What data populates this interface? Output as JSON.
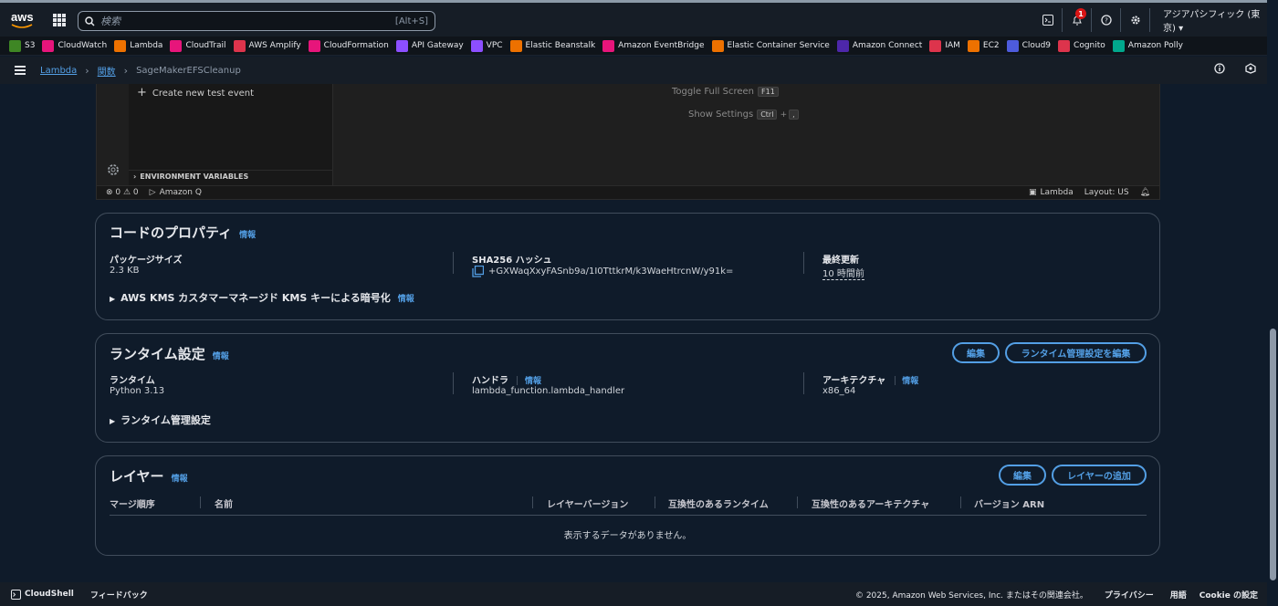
{
  "topbar": {
    "logo_text": "aws",
    "search_placeholder": "検索",
    "search_shortcut": "[Alt+S]",
    "notification_count": "1",
    "region": "アジアパシフィック (東京) ▾"
  },
  "favorites": [
    {
      "label": "S3",
      "color": "#3e8624"
    },
    {
      "label": "CloudWatch",
      "color": "#e7157b"
    },
    {
      "label": "Lambda",
      "color": "#ed7100"
    },
    {
      "label": "CloudTrail",
      "color": "#e7157b"
    },
    {
      "label": "AWS Amplify",
      "color": "#dd344c"
    },
    {
      "label": "CloudFormation",
      "color": "#e7157b"
    },
    {
      "label": "API Gateway",
      "color": "#8c4fff"
    },
    {
      "label": "VPC",
      "color": "#8c4fff"
    },
    {
      "label": "Elastic Beanstalk",
      "color": "#ed7100"
    },
    {
      "label": "Amazon EventBridge",
      "color": "#e7157b"
    },
    {
      "label": "Elastic Container Service",
      "color": "#ed7100"
    },
    {
      "label": "Amazon Connect",
      "color": "#4d27aa"
    },
    {
      "label": "IAM",
      "color": "#dd344c"
    },
    {
      "label": "EC2",
      "color": "#ed7100"
    },
    {
      "label": "Cloud9",
      "color": "#4d5bdc"
    },
    {
      "label": "Cognito",
      "color": "#dd344c"
    },
    {
      "label": "Amazon Polly",
      "color": "#01a88d"
    }
  ],
  "breadcrumb": {
    "items": [
      "Lambda",
      "関数"
    ],
    "current": "SageMakerEFSCleanup"
  },
  "editor": {
    "create_test_event": "Create new test event",
    "toggle_fullscreen": "Toggle Full Screen",
    "toggle_fullscreen_key": "F11",
    "show_settings": "Show Settings",
    "show_settings_key1": "Ctrl",
    "show_settings_plus": "+",
    "show_settings_key2": ",",
    "env_vars": "ENVIRONMENT VARIABLES",
    "status_errors": "⊗ 0 ⚠ 0",
    "status_amazonq": "Amazon Q",
    "status_lambda": "Lambda",
    "status_layout": "Layout: US"
  },
  "code_props": {
    "title": "コードのプロパティ",
    "info": "情報",
    "package_size_label": "パッケージサイズ",
    "package_size_value": "2.3 KB",
    "sha_label": "SHA256 ハッシュ",
    "sha_value": "+GXWaqXxyFASnb9a/1I0TttkrM/k3WaeHtrcnW/y91k=",
    "last_modified_label": "最終更新",
    "last_modified_value": "10 時間前",
    "kms_label": "AWS KMS カスタマーマネージド KMS キーによる暗号化",
    "kms_info": "情報"
  },
  "runtime": {
    "title": "ランタイム設定",
    "info": "情報",
    "edit_btn": "編集",
    "edit_mgmt_btn": "ランタイム管理設定を編集",
    "runtime_label": "ランタイム",
    "runtime_value": "Python 3.13",
    "handler_label": "ハンドラ",
    "handler_info": "情報",
    "handler_value": "lambda_function.lambda_handler",
    "arch_label": "アーキテクチャ",
    "arch_info": "情報",
    "arch_value": "x86_64",
    "mgmt_label": "ランタイム管理設定"
  },
  "layers": {
    "title": "レイヤー",
    "info": "情報",
    "edit_btn": "編集",
    "add_btn": "レイヤーの追加",
    "columns": [
      "マージ順序",
      "名前",
      "レイヤーバージョン",
      "互換性のあるランタイム",
      "互換性のあるアーキテクチャ",
      "バージョン ARN"
    ],
    "empty": "表示するデータがありません。"
  },
  "footer": {
    "cloudshell": "CloudShell",
    "feedback": "フィードバック",
    "copyright": "© 2025, Amazon Web Services, Inc. またはその関連会社。",
    "privacy": "プライバシー",
    "terms": "用語",
    "cookie": "Cookie の設定"
  }
}
